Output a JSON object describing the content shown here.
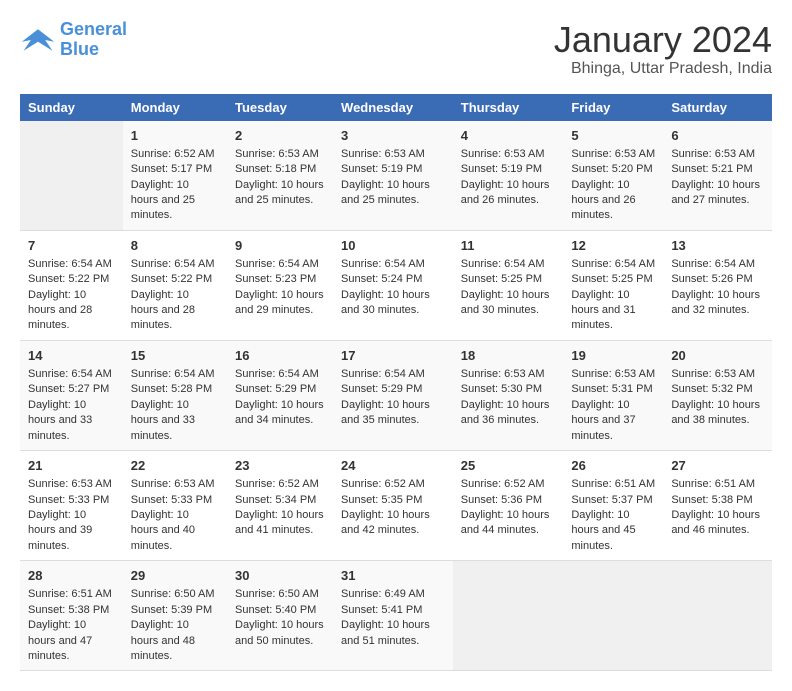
{
  "logo": {
    "line1": "General",
    "line2": "Blue"
  },
  "title": "January 2024",
  "subtitle": "Bhinga, Uttar Pradesh, India",
  "days_of_week": [
    "Sunday",
    "Monday",
    "Tuesday",
    "Wednesday",
    "Thursday",
    "Friday",
    "Saturday"
  ],
  "weeks": [
    [
      {
        "day": "",
        "empty": true
      },
      {
        "day": "1",
        "sunrise": "Sunrise: 6:52 AM",
        "sunset": "Sunset: 5:17 PM",
        "daylight": "Daylight: 10 hours and 25 minutes."
      },
      {
        "day": "2",
        "sunrise": "Sunrise: 6:53 AM",
        "sunset": "Sunset: 5:18 PM",
        "daylight": "Daylight: 10 hours and 25 minutes."
      },
      {
        "day": "3",
        "sunrise": "Sunrise: 6:53 AM",
        "sunset": "Sunset: 5:19 PM",
        "daylight": "Daylight: 10 hours and 25 minutes."
      },
      {
        "day": "4",
        "sunrise": "Sunrise: 6:53 AM",
        "sunset": "Sunset: 5:19 PM",
        "daylight": "Daylight: 10 hours and 26 minutes."
      },
      {
        "day": "5",
        "sunrise": "Sunrise: 6:53 AM",
        "sunset": "Sunset: 5:20 PM",
        "daylight": "Daylight: 10 hours and 26 minutes."
      },
      {
        "day": "6",
        "sunrise": "Sunrise: 6:53 AM",
        "sunset": "Sunset: 5:21 PM",
        "daylight": "Daylight: 10 hours and 27 minutes."
      }
    ],
    [
      {
        "day": "7",
        "sunrise": "Sunrise: 6:54 AM",
        "sunset": "Sunset: 5:22 PM",
        "daylight": "Daylight: 10 hours and 28 minutes."
      },
      {
        "day": "8",
        "sunrise": "Sunrise: 6:54 AM",
        "sunset": "Sunset: 5:22 PM",
        "daylight": "Daylight: 10 hours and 28 minutes."
      },
      {
        "day": "9",
        "sunrise": "Sunrise: 6:54 AM",
        "sunset": "Sunset: 5:23 PM",
        "daylight": "Daylight: 10 hours and 29 minutes."
      },
      {
        "day": "10",
        "sunrise": "Sunrise: 6:54 AM",
        "sunset": "Sunset: 5:24 PM",
        "daylight": "Daylight: 10 hours and 30 minutes."
      },
      {
        "day": "11",
        "sunrise": "Sunrise: 6:54 AM",
        "sunset": "Sunset: 5:25 PM",
        "daylight": "Daylight: 10 hours and 30 minutes."
      },
      {
        "day": "12",
        "sunrise": "Sunrise: 6:54 AM",
        "sunset": "Sunset: 5:25 PM",
        "daylight": "Daylight: 10 hours and 31 minutes."
      },
      {
        "day": "13",
        "sunrise": "Sunrise: 6:54 AM",
        "sunset": "Sunset: 5:26 PM",
        "daylight": "Daylight: 10 hours and 32 minutes."
      }
    ],
    [
      {
        "day": "14",
        "sunrise": "Sunrise: 6:54 AM",
        "sunset": "Sunset: 5:27 PM",
        "daylight": "Daylight: 10 hours and 33 minutes."
      },
      {
        "day": "15",
        "sunrise": "Sunrise: 6:54 AM",
        "sunset": "Sunset: 5:28 PM",
        "daylight": "Daylight: 10 hours and 33 minutes."
      },
      {
        "day": "16",
        "sunrise": "Sunrise: 6:54 AM",
        "sunset": "Sunset: 5:29 PM",
        "daylight": "Daylight: 10 hours and 34 minutes."
      },
      {
        "day": "17",
        "sunrise": "Sunrise: 6:54 AM",
        "sunset": "Sunset: 5:29 PM",
        "daylight": "Daylight: 10 hours and 35 minutes."
      },
      {
        "day": "18",
        "sunrise": "Sunrise: 6:53 AM",
        "sunset": "Sunset: 5:30 PM",
        "daylight": "Daylight: 10 hours and 36 minutes."
      },
      {
        "day": "19",
        "sunrise": "Sunrise: 6:53 AM",
        "sunset": "Sunset: 5:31 PM",
        "daylight": "Daylight: 10 hours and 37 minutes."
      },
      {
        "day": "20",
        "sunrise": "Sunrise: 6:53 AM",
        "sunset": "Sunset: 5:32 PM",
        "daylight": "Daylight: 10 hours and 38 minutes."
      }
    ],
    [
      {
        "day": "21",
        "sunrise": "Sunrise: 6:53 AM",
        "sunset": "Sunset: 5:33 PM",
        "daylight": "Daylight: 10 hours and 39 minutes."
      },
      {
        "day": "22",
        "sunrise": "Sunrise: 6:53 AM",
        "sunset": "Sunset: 5:33 PM",
        "daylight": "Daylight: 10 hours and 40 minutes."
      },
      {
        "day": "23",
        "sunrise": "Sunrise: 6:52 AM",
        "sunset": "Sunset: 5:34 PM",
        "daylight": "Daylight: 10 hours and 41 minutes."
      },
      {
        "day": "24",
        "sunrise": "Sunrise: 6:52 AM",
        "sunset": "Sunset: 5:35 PM",
        "daylight": "Daylight: 10 hours and 42 minutes."
      },
      {
        "day": "25",
        "sunrise": "Sunrise: 6:52 AM",
        "sunset": "Sunset: 5:36 PM",
        "daylight": "Daylight: 10 hours and 44 minutes."
      },
      {
        "day": "26",
        "sunrise": "Sunrise: 6:51 AM",
        "sunset": "Sunset: 5:37 PM",
        "daylight": "Daylight: 10 hours and 45 minutes."
      },
      {
        "day": "27",
        "sunrise": "Sunrise: 6:51 AM",
        "sunset": "Sunset: 5:38 PM",
        "daylight": "Daylight: 10 hours and 46 minutes."
      }
    ],
    [
      {
        "day": "28",
        "sunrise": "Sunrise: 6:51 AM",
        "sunset": "Sunset: 5:38 PM",
        "daylight": "Daylight: 10 hours and 47 minutes."
      },
      {
        "day": "29",
        "sunrise": "Sunrise: 6:50 AM",
        "sunset": "Sunset: 5:39 PM",
        "daylight": "Daylight: 10 hours and 48 minutes."
      },
      {
        "day": "30",
        "sunrise": "Sunrise: 6:50 AM",
        "sunset": "Sunset: 5:40 PM",
        "daylight": "Daylight: 10 hours and 50 minutes."
      },
      {
        "day": "31",
        "sunrise": "Sunrise: 6:49 AM",
        "sunset": "Sunset: 5:41 PM",
        "daylight": "Daylight: 10 hours and 51 minutes."
      },
      {
        "day": "",
        "empty": true
      },
      {
        "day": "",
        "empty": true
      },
      {
        "day": "",
        "empty": true
      }
    ]
  ]
}
